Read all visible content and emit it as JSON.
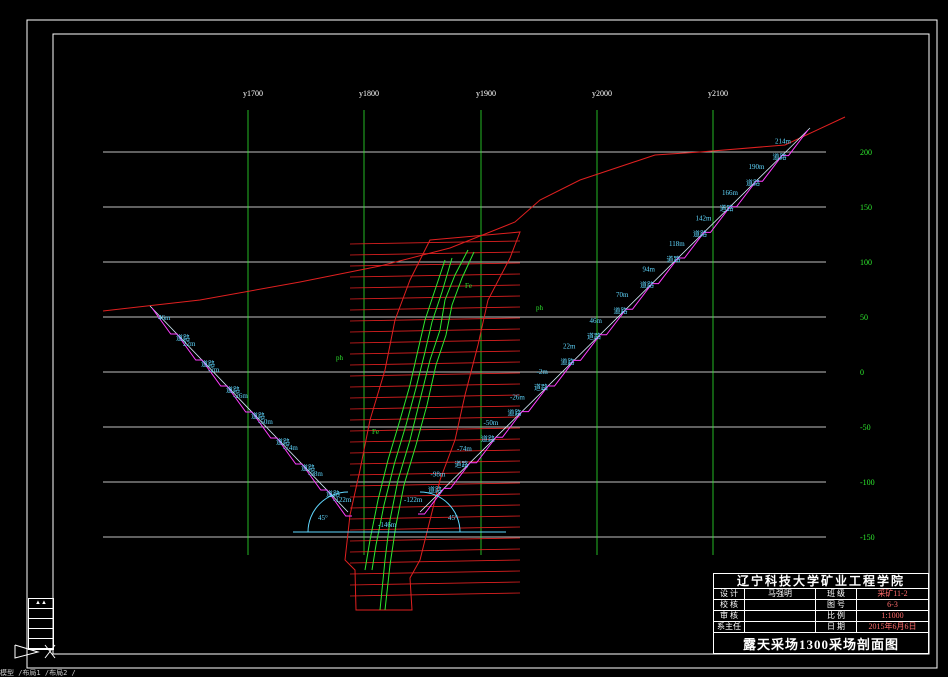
{
  "exploration_lines": [
    "y1700",
    "y1800",
    "y1900",
    "y2000",
    "y2100"
  ],
  "elevation_labels": [
    "200",
    "150",
    "100",
    "50",
    "0",
    "-50",
    "-100",
    "-150"
  ],
  "ore_labels": {
    "fe1": "Fe",
    "fe2": "Fe",
    "ph1": "ph",
    "ph2": "ph"
  },
  "bench_labels_left": [
    "46m",
    "22m",
    "-2m",
    "-26m",
    "-50m",
    "-74m",
    "-98m",
    "-122m"
  ],
  "bench_labels_right": [
    "-122m",
    "-98m",
    "-74m",
    "-50m",
    "-26m",
    "-2m",
    "22m",
    "46m",
    "70m",
    "94m",
    "118m",
    "142m",
    "166m",
    "190m",
    "214m"
  ],
  "road_label": "道路",
  "bottom_label": "-146m",
  "angle_left": "45°",
  "angle_right": "45°",
  "title_block": {
    "institution": "辽宁科技大学矿业工程学院",
    "rows": [
      [
        "设 计",
        "马强明",
        "班 级",
        "采矿11-2"
      ],
      [
        "校 核",
        "",
        "图 号",
        "6-3"
      ],
      [
        "审 核",
        "",
        "比 例",
        "1:1000"
      ],
      [
        "系主任",
        "",
        "日 期",
        "2015年6月6日"
      ]
    ],
    "drawing_title": "露天采场1300采场剖面图"
  },
  "command_line": "模型 /布局1 /布局2 /"
}
